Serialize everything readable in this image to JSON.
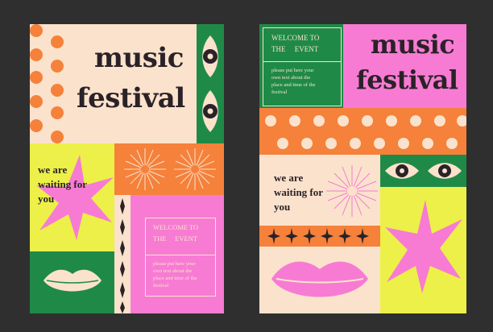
{
  "colors": {
    "background": "#2f2f2f",
    "cream": "#fbe2cc",
    "orange": "#f5813b",
    "yellow": "#ecf048",
    "pink": "#f77bd3",
    "green": "#1f8a48",
    "dark": "#2a2228"
  },
  "poster_left": {
    "title_line1": "music",
    "title_line2": "festival",
    "waiting_line1": "we are",
    "waiting_line2": "waiting for",
    "waiting_line3": "you",
    "welcome_line1": "WELCOME TO",
    "welcome_line2": "THE     EVENT",
    "info_line1": "please put here your",
    "info_line2": "own text about the",
    "info_line3": "place and time of the",
    "info_line4": "festival"
  },
  "poster_right": {
    "title_line1": "music",
    "title_line2": "festival",
    "waiting_line1": "we are",
    "waiting_line2": "waiting for",
    "waiting_line3": "you",
    "welcome_line1": "WELCOME TO",
    "welcome_line2": "THE     EVENT",
    "info_line1": "please put here your",
    "info_line2": "own text about the",
    "info_line3": "place and time of the",
    "info_line4": "festival"
  },
  "icons": [
    "eye-icon",
    "sunburst-icon",
    "starburst-icon",
    "lips-icon",
    "four-point-star-icon"
  ]
}
